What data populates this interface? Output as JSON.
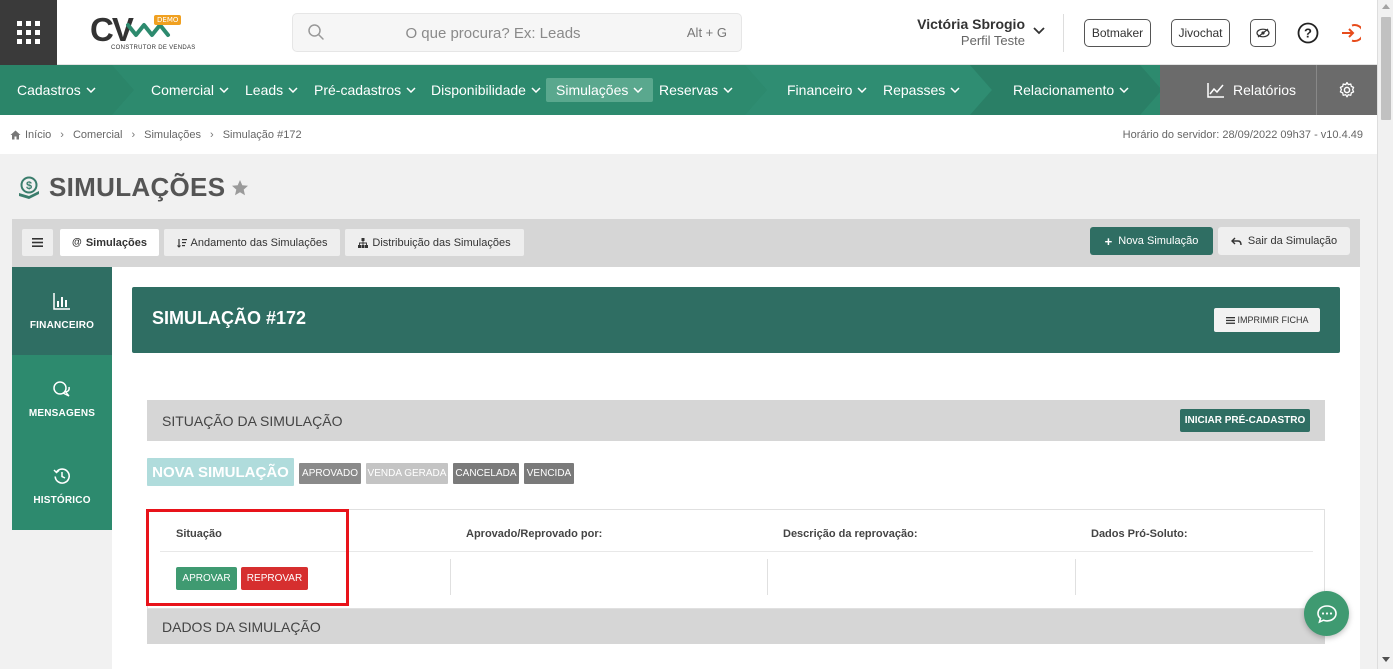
{
  "app": {
    "logo_text": "CV",
    "logo_badge": "DEMO",
    "logo_subtitle": "CONSTRUTOR DE VENDAS"
  },
  "search": {
    "placeholder": "O que procura? Ex: Leads",
    "shortcut": "Alt + G"
  },
  "user": {
    "name": "Victória Sbrogio",
    "profile": "Perfil Teste"
  },
  "top_buttons": {
    "botmaker": "Botmaker",
    "jivochat": "Jivochat"
  },
  "nav": {
    "items": [
      {
        "label": "Cadastros"
      },
      {
        "label": "Comercial"
      },
      {
        "label": "Leads"
      },
      {
        "label": "Pré-cadastros"
      },
      {
        "label": "Disponibilidade"
      },
      {
        "label": "Simulações"
      },
      {
        "label": "Reservas"
      },
      {
        "label": "Financeiro"
      },
      {
        "label": "Repasses"
      },
      {
        "label": "Relacionamento"
      }
    ],
    "reports": "Relatórios",
    "active": "Simulações"
  },
  "breadcrumb": {
    "items": [
      "Início",
      "Comercial",
      "Simulações",
      "Simulação #172"
    ],
    "server_time": "Horário do servidor: 28/09/2022 09h37 - v10.4.49"
  },
  "page": {
    "title": "SIMULAÇÕES"
  },
  "tabs": {
    "simulacoes": "Simulações",
    "andamento": "Andamento das Simulações",
    "distribuicao": "Distribuição das Simulações",
    "nova": "Nova Simulação",
    "sair": "Sair da Simulação"
  },
  "side": {
    "financeiro": "FINANCEIRO",
    "mensagens": "MENSAGENS",
    "historico": "HISTÓRICO"
  },
  "simulation": {
    "title": "SIMULAÇÃO #172",
    "print": "IMPRIMIR FICHA",
    "status_section": "SITUAÇÃO DA SIMULAÇÃO",
    "start_precadastro": "INICIAR PRÉ-CADASTRO",
    "statuses": {
      "current": "NOVA SIMULAÇÃO",
      "aprovado": "APROVADO",
      "venda_gerada": "VENDA GERADA",
      "cancelada": "CANCELADA",
      "vencida": "VENCIDA"
    },
    "status_colors": {
      "current": "#b0dcdc",
      "aprovado": "#8a8a8a",
      "venda_gerada": "#c4c4c4",
      "cancelada": "#7a7a7a",
      "vencida": "#7a7a7a"
    },
    "table": {
      "headers": [
        "Situação",
        "Aprovado/Reprovado por:",
        "Descrição da reprovação:",
        "Dados Pró-Soluto:"
      ],
      "approve": "APROVAR",
      "reject": "REPROVAR"
    },
    "data_section": "DADOS DA SIMULAÇÃO"
  },
  "colors": {
    "nav_green": "#2d8a6e",
    "dark_teal": "#2f6e63",
    "highlight_red": "#e8131a",
    "reject_red": "#d62f2f"
  }
}
